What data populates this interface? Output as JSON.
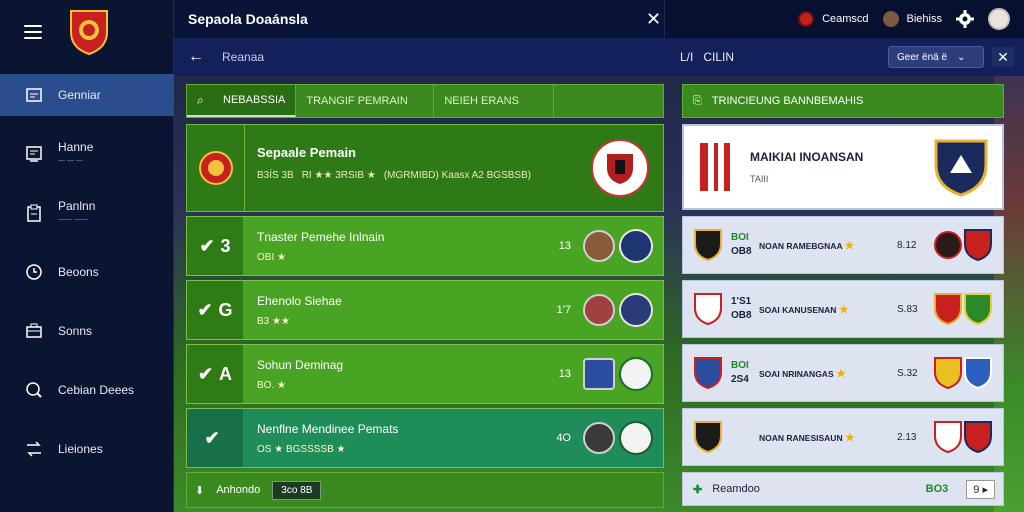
{
  "header": {
    "title": "Sepaola Doaánsla",
    "user1": "Ceamscd",
    "user2": "Biehiss"
  },
  "subheader": {
    "breadcrumb": "Reanaa",
    "stat_icon": "L/I",
    "stat_text": "CILIN",
    "select_value": "Geer ënä ë"
  },
  "sidebar": {
    "items": [
      {
        "label": "Genniar",
        "icon": "dashboard-icon",
        "active": true
      },
      {
        "label": "Hanne",
        "sub": "— — —",
        "icon": "squad-icon"
      },
      {
        "label": "Panlnn",
        "sub": "—— ——",
        "icon": "clipboard-icon"
      },
      {
        "label": "Beoons",
        "icon": "clock-icon"
      },
      {
        "label": "Sonns",
        "icon": "briefcase-icon"
      },
      {
        "label": "Cebian Deees",
        "icon": "search-icon"
      },
      {
        "label": "Lieiones",
        "icon": "transfer-icon"
      }
    ]
  },
  "main": {
    "tabs": [
      "NEBABSSIA",
      "TRANGIF PEMRAIN",
      "NEIEH ERANS"
    ],
    "featured": {
      "name": "Sepaale Pemain",
      "meta1": "B3ÍS 3B",
      "meta2": "RI ★★ 3RSIB ★",
      "meta3": "(MGRMIBD) Kaasx A2 BGSBSB)"
    },
    "rows": [
      {
        "num": "3",
        "name": "Tnaster Pemehe Inlnain",
        "meta": "OBI ★",
        "score": "13"
      },
      {
        "num": "G",
        "name": "Ehenolo Siehae",
        "meta": "B3 ★★",
        "score": "1'7"
      },
      {
        "num": "A",
        "name": "Sohun Deminag",
        "meta": "BO. ★",
        "score": "13"
      },
      {
        "num": "",
        "name": "Nenflne Mendinee Pemats",
        "meta": "OS ★ BGSSSSB ★",
        "score": "4O"
      }
    ],
    "footer": {
      "label": "Anhondo",
      "pill": "3co  8B"
    }
  },
  "rpanel": {
    "title": "TRINCIEUNG BANNBEMAHIS",
    "card": {
      "title": "MAIKIAI INOANSAN",
      "sub": "TAIII"
    },
    "matches": [
      {
        "score1": "BOI",
        "score2": "OB8",
        "name": "NOAN RAMEBGNAA",
        "odds": "8.12"
      },
      {
        "score1": "1'S1",
        "score2": "OB8",
        "name": "SOAI KANUSENAN",
        "odds": "S.83"
      },
      {
        "score1": "BOI",
        "score2": "2S4",
        "name": "SOAI NRINANGAS",
        "odds": "S.32"
      },
      {
        "score1": "",
        "score2": "",
        "name": "NOAN RANESISAUN",
        "odds": "2.13"
      }
    ],
    "footer": {
      "label": "Reamdoo",
      "score": "BO3",
      "page": "9"
    }
  }
}
